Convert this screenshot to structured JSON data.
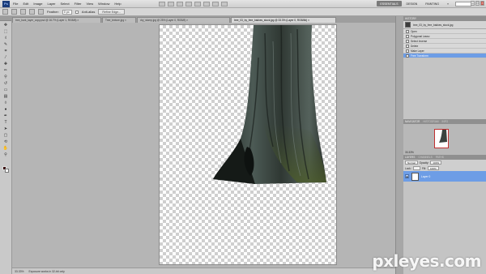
{
  "app": {
    "logo_text": "Ps"
  },
  "menu": [
    "File",
    "Edit",
    "Image",
    "Layer",
    "Select",
    "Filter",
    "View",
    "Window",
    "Help"
  ],
  "workspaces": [
    "ESSENTIALS",
    "DESIGN",
    "PAINTING",
    "»"
  ],
  "window_controls": [
    "–",
    "□",
    "×"
  ],
  "options": {
    "feather_label": "Feather:",
    "feather_value": "0 px",
    "antialias_label": "Anti-alias",
    "refine_label": "Refine Edge..."
  },
  "tabs": [
    "tree_bark_layer_copy.psd @ 16.7% (Layer 1, RGB/8) ×",
    "Tree_texture.jpg ×",
    "dry_stump.jpg @ 25% (Layer 0, RGB/8) ×",
    "tree_03_by_free_bakkes_stock.jpg @ 33.3% (Layer 0, RGB/8#) ×"
  ],
  "active_tab": 3,
  "status": {
    "zoom": "33.33%",
    "doc": "Exposure works in 32-bit only"
  },
  "history": {
    "title": "HISTORY",
    "doc_name": "tree_03_by_free_bakkes_stock.jpg",
    "items": [
      "Open",
      "Polygonal Lasso",
      "Select Inverse",
      "Delete",
      "Make Layer",
      "Free Transform"
    ],
    "selected_index": 5
  },
  "navigator": {
    "title": "NAVIGATOR",
    "tab2": "HISTOGRAM",
    "tab3": "INFO",
    "zoom": "33.33%"
  },
  "layers": {
    "tabs": [
      "LAYERS",
      "CHANNELS",
      "PATHS"
    ],
    "blend_mode": "Normal",
    "opacity_label": "Opacity:",
    "opacity_value": "100%",
    "lock_label": "Lock:",
    "fill_label": "Fill:",
    "fill_value": "100%",
    "items": [
      {
        "name": "Layer 0"
      }
    ]
  },
  "watermark": "pxleyes.com",
  "colors": {
    "selection": "#6d9de6",
    "foreground": "#3a1010",
    "background": "#ffffff"
  }
}
